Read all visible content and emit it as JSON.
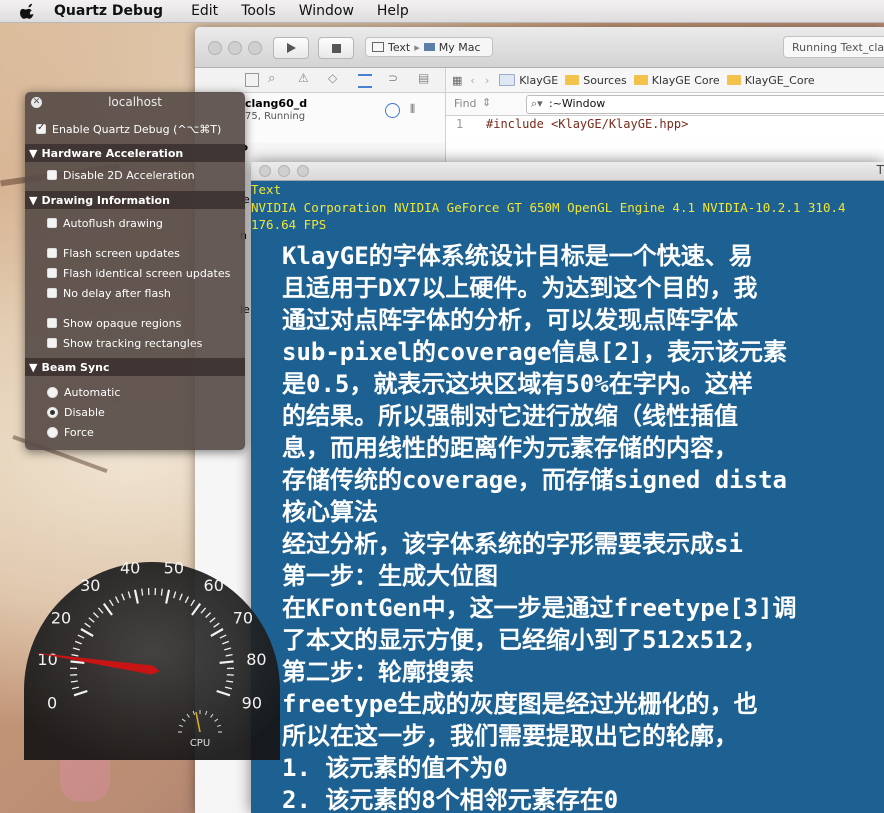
{
  "menubar": {
    "app_name": "Quartz Debug",
    "items": [
      "Edit",
      "Tools",
      "Window",
      "Help"
    ]
  },
  "xcode": {
    "scheme": {
      "target": "Text",
      "device": "My Mac"
    },
    "status": "Running Text_clang",
    "left_item": {
      "name": "clang60_d",
      "detail": "75, Running",
      "partials": [
        "P",
        "le",
        "n",
        "le"
      ]
    },
    "jump_bar": [
      "KlayGE",
      "Sources",
      "KlayGE Core",
      "KlayGE_Core"
    ],
    "find": {
      "label": "Find",
      "query": ":~Window"
    },
    "editor_line_number": "1",
    "editor_first_line": "#include <KlayGE/KlayGE.hpp>"
  },
  "text_window": {
    "title": "T",
    "info_lines": [
      "Text",
      "NVIDIA Corporation NVIDIA GeForce GT 650M OpenGL Engine 4.1 NVIDIA-10.2.1 310.4",
      "176.64 FPS"
    ],
    "content_lines": [
      "KlayGE的字体系统设计目标是一个快速、易",
      "且适用于DX7以上硬件。为达到这个目的，我",
      "通过对点阵字体的分析，可以发现点阵字体",
      "sub-pixel的coverage信息[2]，表示该元素",
      "是0.5，就表示这块区域有50%在字内。这样",
      "的结果。所以强制对它进行放缩（线性插值",
      "息，而用线性的距离作为元素存储的内容，",
      "存储传统的coverage，而存储signed dista",
      "核心算法",
      "经过分析，该字体系统的字形需要表示成si",
      "第一步：生成大位图",
      "在KFontGen中，这一步是通过freetype[3]调",
      "了本文的显示方便，已经缩小到了512x512，",
      "第二步：轮廓搜索",
      "freetype生成的灰度图是经过光栅化的，也",
      "所以在这一步，我们需要提取出它的轮廓，",
      "   1. 该元素的值不为0",
      "   2. 该元素的8个相邻元素存在0"
    ]
  },
  "quartz_debug": {
    "title": "localhost",
    "enable": {
      "label": "Enable Quartz Debug (^⌥⌘T)",
      "checked": true
    },
    "sections": {
      "hardware": "Hardware Acceleration",
      "drawing": "Drawing Information",
      "beam": "Beam Sync"
    },
    "hardware_items": [
      {
        "label": "Disable 2D Acceleration",
        "checked": false
      }
    ],
    "drawing_items": [
      {
        "label": "Autoflush drawing",
        "checked": false
      },
      {
        "label": "Flash screen updates",
        "checked": false
      },
      {
        "label": "Flash identical screen updates",
        "checked": false
      },
      {
        "label": "No delay after flash",
        "checked": false
      },
      {
        "label": "Show opaque regions",
        "checked": false
      },
      {
        "label": "Show tracking rectangles",
        "checked": false
      }
    ],
    "beam_options": [
      {
        "label": "Automatic",
        "selected": false
      },
      {
        "label": "Disable",
        "selected": true
      },
      {
        "label": "Force",
        "selected": false
      }
    ]
  },
  "cpu_gauge": {
    "ticks": [
      "0",
      "10",
      "20",
      "30",
      "40",
      "50",
      "60",
      "70",
      "80",
      "90"
    ],
    "needle_value": 11,
    "label": "CPU"
  },
  "colors": {
    "text_bg": "#1d6193",
    "info_text": "#f3e533",
    "needle": "#c81414"
  }
}
